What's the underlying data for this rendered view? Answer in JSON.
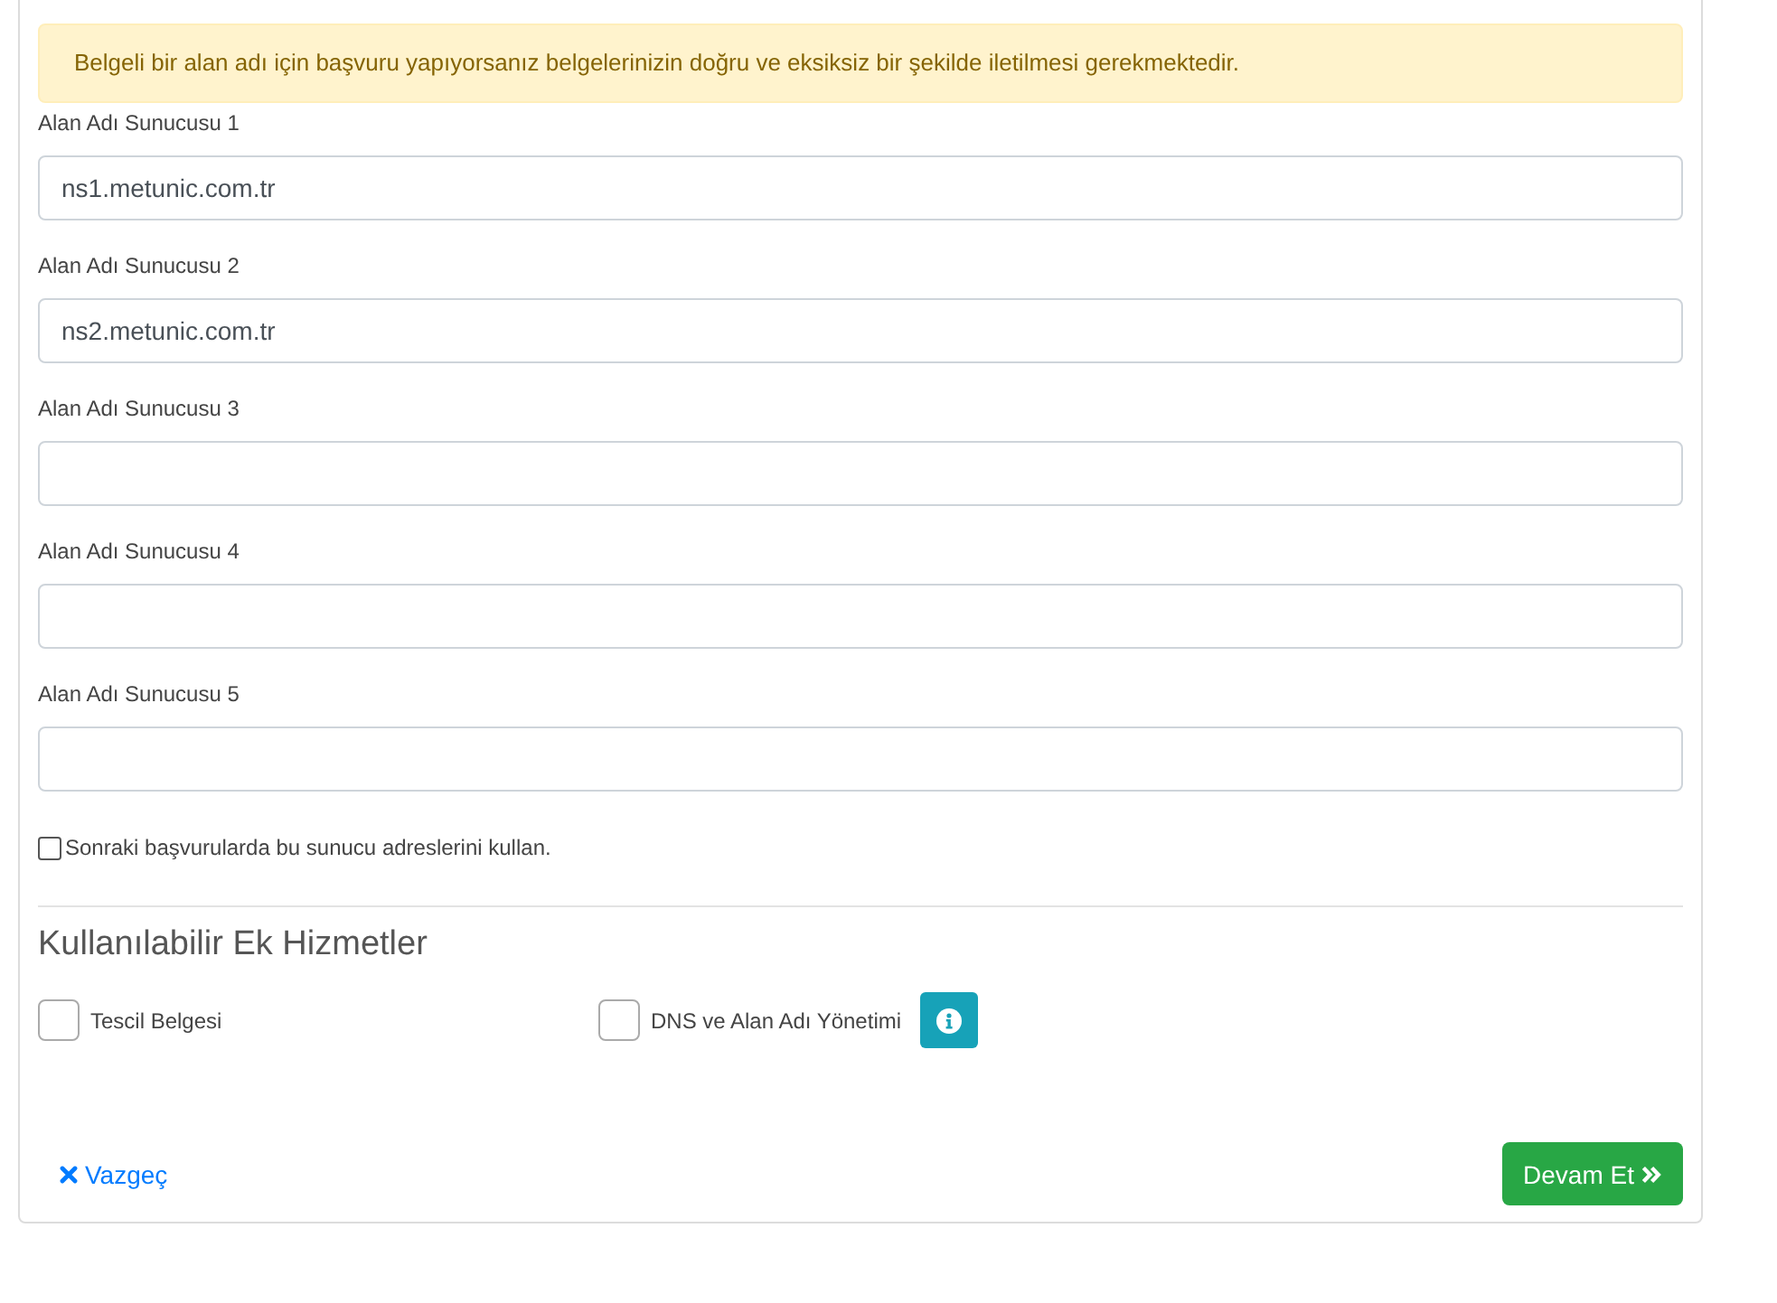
{
  "alert": {
    "text": "Belgeli bir alan adı için başvuru yapıyorsanız belgelerinizin doğru ve eksiksiz bir şekilde iletilmesi gerekmektedir."
  },
  "nameservers": [
    {
      "label": "Alan Adı Sunucusu 1",
      "value": "ns1.metunic.com.tr"
    },
    {
      "label": "Alan Adı Sunucusu 2",
      "value": "ns2.metunic.com.tr"
    },
    {
      "label": "Alan Adı Sunucusu 3"
    },
    {
      "label": "Alan Adı Sunucusu 4"
    },
    {
      "label": "Alan Adı Sunucusu 5"
    }
  ],
  "remember": {
    "label": "Sonraki başvurularda bu sunucu adreslerini kullan.",
    "checked": false
  },
  "addons": {
    "title": "Kullanılabilir Ek Hizmetler",
    "items": [
      {
        "label": "Tescil Belgesi",
        "checked": false,
        "has_info": false
      },
      {
        "label": "DNS ve Alan Adı Yönetimi",
        "checked": false,
        "has_info": true
      }
    ]
  },
  "footer": {
    "cancel": {
      "label": "Vazgeç"
    },
    "next": {
      "label": "Devam Et"
    }
  }
}
